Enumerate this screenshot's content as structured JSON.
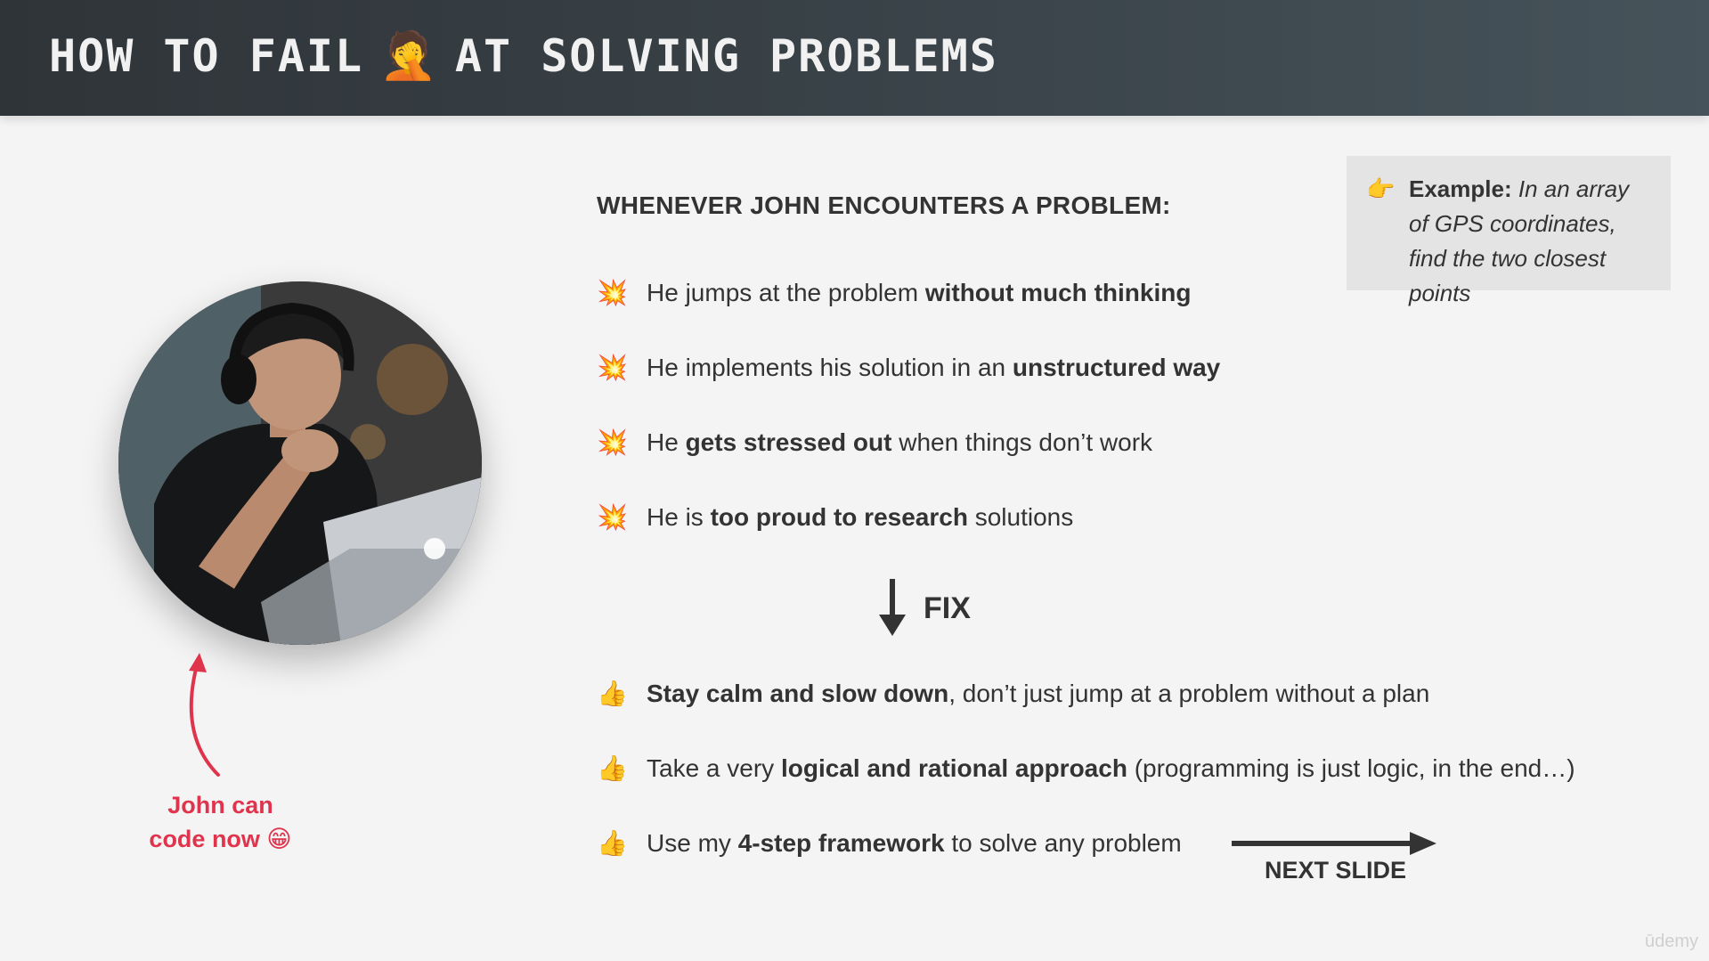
{
  "header": {
    "title_part1": "HOW TO FAIL",
    "title_emoji": "🤦",
    "title_part2": "AT SOLVING PROBLEMS"
  },
  "caption": {
    "line1": "John can",
    "line2": "code now 😁"
  },
  "example": {
    "icon": "👉",
    "label": "Example:",
    "text": "In an array of GPS coordinates, find the two closest points"
  },
  "problems": {
    "heading": "WHENEVER JOHN ENCOUNTERS A PROBLEM:",
    "icon": "💥",
    "items": [
      {
        "pre": "He jumps at the problem ",
        "bold": "without much thinking",
        "post": ""
      },
      {
        "pre": "He implements his solution in an ",
        "bold": "unstructured way",
        "post": ""
      },
      {
        "pre": "He ",
        "bold": "gets stressed out",
        "post": " when things don’t work"
      },
      {
        "pre": "He is ",
        "bold": "too proud to research",
        "post": " solutions"
      }
    ]
  },
  "fix": {
    "label": "FIX"
  },
  "fixes": {
    "icon": "👍",
    "items": [
      {
        "pre": "",
        "bold": "Stay calm and slow down",
        "post": ", don’t just jump at a problem without a plan"
      },
      {
        "pre": "Take a very ",
        "bold": "logical and rational approach",
        "post": " (programming is just logic, in the end…)"
      },
      {
        "pre": "Use my ",
        "bold": "4-step framework",
        "post": " to solve any problem"
      }
    ]
  },
  "next_slide": {
    "label": "NEXT SLIDE"
  },
  "watermark": "ūdemy",
  "colors": {
    "accent_red": "#e0344d",
    "header_dark": "#2f3438",
    "text_dark": "#333333"
  }
}
